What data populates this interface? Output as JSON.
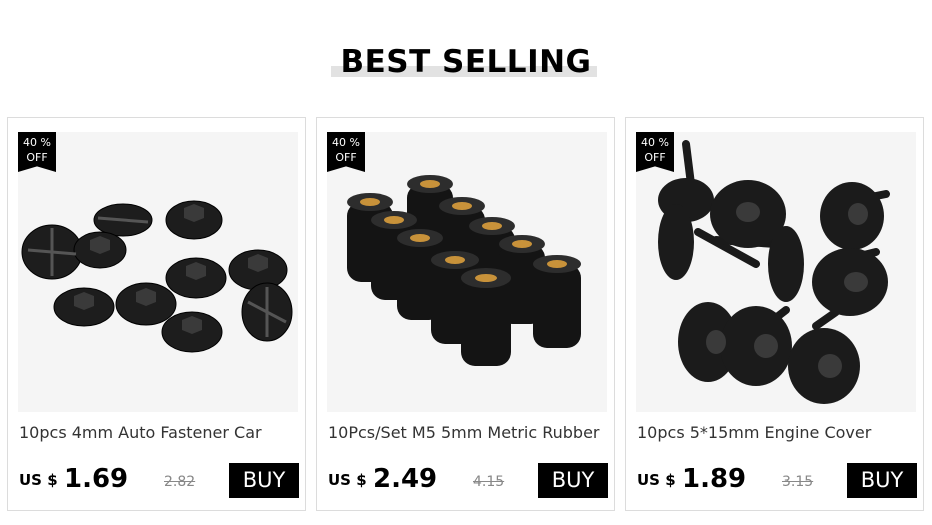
{
  "section": {
    "heading": "BEST SELLING"
  },
  "products": [
    {
      "discount_line1": "40 %",
      "discount_line2": "OFF",
      "title": "10pcs 4mm Auto Fastener Car",
      "currency": "US $",
      "price": "1.69",
      "old_price": "2.82",
      "buy_label": "BUY",
      "image_icon": "plastic-nut-clips-image"
    },
    {
      "discount_line1": "40 %",
      "discount_line2": "OFF",
      "title": "10Pcs/Set M5 5mm Metric Rubber",
      "currency": "US $",
      "price": "2.49",
      "old_price": "4.15",
      "buy_label": "BUY",
      "image_icon": "rubber-well-nuts-image"
    },
    {
      "discount_line1": "40 %",
      "discount_line2": "OFF",
      "title": "10pcs 5*15mm Engine Cover",
      "currency": "US $",
      "price": "1.89",
      "old_price": "3.15",
      "buy_label": "BUY",
      "image_icon": "torx-screws-image"
    }
  ]
}
